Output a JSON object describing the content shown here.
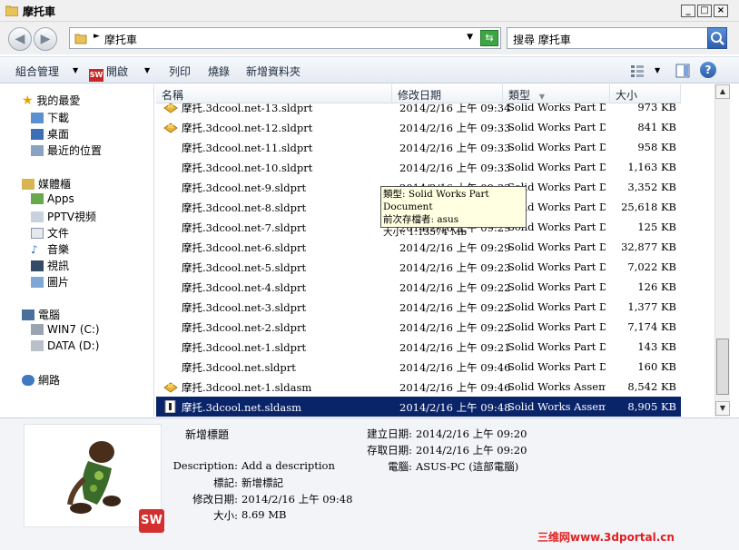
{
  "window": {
    "title": "摩托車"
  },
  "address": {
    "path": "摩托車",
    "search_placeholder": "搜尋 摩托車"
  },
  "toolbar": {
    "organize": "組合管理",
    "open": "開啟",
    "print": "列印",
    "burn": "燒錄",
    "new_folder": "新增資料夾"
  },
  "nav": {
    "favorites": "我的最愛",
    "favorites_items": [
      "下載",
      "桌面",
      "最近的位置"
    ],
    "libraries": "媒體櫃",
    "libraries_items": [
      "Apps",
      "PPTV視频",
      "文件",
      "音樂",
      "視訊",
      "圖片"
    ],
    "computer": "電腦",
    "computer_items": [
      "WIN7 (C:)",
      "DATA (D:)"
    ],
    "network": "網路"
  },
  "columns": {
    "name": "名稱",
    "modified": "修改日期",
    "type": "類型",
    "size": "大小"
  },
  "files": [
    {
      "name": "摩托.3dcool.net-13.sldprt",
      "date": "2014/2/16 上午 09:34",
      "type": "Solid Works Part Do...",
      "size": "973 KB"
    },
    {
      "name": "摩托.3dcool.net-12.sldprt",
      "date": "2014/2/16 上午 09:33",
      "type": "Solid Works Part Do...",
      "size": "841 KB"
    },
    {
      "name": "摩托.3dcool.net-11.sldprt",
      "date": "2014/2/16 上午 09:33",
      "type": "Solid Works Part Do...",
      "size": "958 KB"
    },
    {
      "name": "摩托.3dcool.net-10.sldprt",
      "date": "2014/2/16 上午 09:33",
      "type": "Solid Works Part Do...",
      "size": "1,163 KB"
    },
    {
      "name": "摩托.3dcool.net-9.sldprt",
      "date": "2014/2/16 上午 09:33",
      "type": "Solid Works Part Do...",
      "size": "3,352 KB"
    },
    {
      "name": "摩托.3dcool.net-8.sldprt",
      "date": "2014/2/16 上午 09:32",
      "type": "Solid Works Part Do...",
      "size": "25,618 KB"
    },
    {
      "name": "摩托.3dcool.net-7.sldprt",
      "date": "2014/2/16 上午 09:29",
      "type": "Solid Works Part Do...",
      "size": "125 KB"
    },
    {
      "name": "摩托.3dcool.net-6.sldprt",
      "date": "2014/2/16 上午 09:29",
      "type": "Solid Works Part Do...",
      "size": "32,877 KB"
    },
    {
      "name": "摩托.3dcool.net-5.sldprt",
      "date": "2014/2/16 上午 09:23",
      "type": "Solid Works Part Do...",
      "size": "7,022 KB"
    },
    {
      "name": "摩托.3dcool.net-4.sldprt",
      "date": "2014/2/16 上午 09:22",
      "type": "Solid Works Part Do...",
      "size": "126 KB"
    },
    {
      "name": "摩托.3dcool.net-3.sldprt",
      "date": "2014/2/16 上午 09:22",
      "type": "Solid Works Part Do...",
      "size": "1,377 KB"
    },
    {
      "name": "摩托.3dcool.net-2.sldprt",
      "date": "2014/2/16 上午 09:22",
      "type": "Solid Works Part Do...",
      "size": "7,174 KB"
    },
    {
      "name": "摩托.3dcool.net-1.sldprt",
      "date": "2014/2/16 上午 09:21",
      "type": "Solid Works Part Do...",
      "size": "143 KB"
    },
    {
      "name": "摩托.3dcool.net.sldprt",
      "date": "2014/2/16 上午 09:46",
      "type": "Solid Works Part Do...",
      "size": "160 KB"
    },
    {
      "name": "摩托.3dcool.net-1.sldasm",
      "date": "2014/2/16 上午 09:46",
      "type": "Solid Works Assembl...",
      "size": "8,542 KB"
    },
    {
      "name": "摩托.3dcool.net.sldasm",
      "date": "2014/2/16 上午 09:48",
      "type": "Solid Works Assembl...",
      "size": "8,905 KB"
    }
  ],
  "tooltip": {
    "line1": "類型: Solid Works Part Document",
    "line2": "前次存檔者: asus",
    "line3": "大小: 1.13574 Mb"
  },
  "details": {
    "title_value": "新增標題",
    "description_label": "Description:",
    "description_value": "Add a description",
    "tags_label": "標記:",
    "tags_value": "新增標記",
    "modified_label": "修改日期:",
    "modified_value": "2014/2/16 上午 09:48",
    "size_label": "大小:",
    "size_value": "8.69 MB",
    "created_label": "建立日期:",
    "created_value": "2014/2/16 上午 09:20",
    "accessed_label": "存取日期:",
    "accessed_value": "2014/2/16 上午 09:20",
    "computer_label": "電腦:",
    "computer_value": "ASUS-PC (這部電腦)",
    "sw_badge": "SW"
  },
  "watermark": "三维网www.3dportal.cn",
  "colors": {
    "selection": "#0a246a",
    "tooltip_bg": "#ffffe1",
    "sw_red": "#d32f2f"
  }
}
